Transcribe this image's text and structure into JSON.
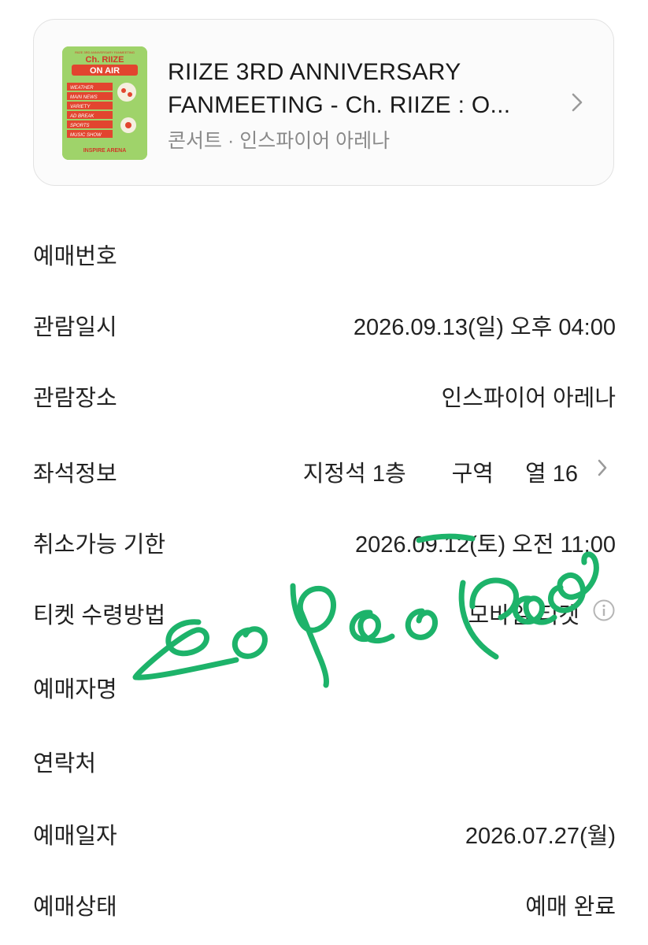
{
  "event_card": {
    "title_line1": "RIIZE 3RD ANNIVERSARY",
    "title_line2": "FANMEETING - Ch. RIIZE : O...",
    "subtitle": "콘서트 · 인스파이어 아레나",
    "chevron_icon": "chevron-right-icon",
    "poster": {
      "heading": "Ch. RIIZE",
      "on_air": "ON AIR",
      "menu": [
        "WEATHER",
        "MAIN NEWS",
        "VARIETY",
        "AD BREAK",
        "SPORTS",
        "MUSIC SHOW"
      ],
      "venue": "INSPIRE ARENA"
    }
  },
  "details": {
    "booking_number": {
      "label": "예매번호",
      "value": ""
    },
    "viewing_datetime": {
      "label": "관람일시",
      "value": "2026.09.13(일) 오후 04:00"
    },
    "venue": {
      "label": "관람장소",
      "value": "인스파이어 아레나"
    },
    "seat": {
      "label": "좌석정보",
      "grade": "지정석 1층",
      "section": "구역",
      "row": "열 16"
    },
    "cancel_deadline": {
      "label": "취소가능 기한",
      "value": "2026.09.12(토) 오전 11:00"
    },
    "ticket_method": {
      "label": "티켓 수령방법",
      "value": "모바일 티켓",
      "icon": "info-icon"
    },
    "booker_name": {
      "label": "예매자명",
      "value": ""
    },
    "contact": {
      "label": "연락처",
      "value": ""
    },
    "booking_date": {
      "label": "예매일자",
      "value": "2026.07.27(월)"
    },
    "booking_status": {
      "label": "예매상태",
      "value": "예매 완료"
    }
  },
  "colors": {
    "poster_green": "#9fd36a",
    "poster_red": "#e2452f",
    "handwriting_green": "#1db36a",
    "secondary_text": "#8a8a8a"
  }
}
